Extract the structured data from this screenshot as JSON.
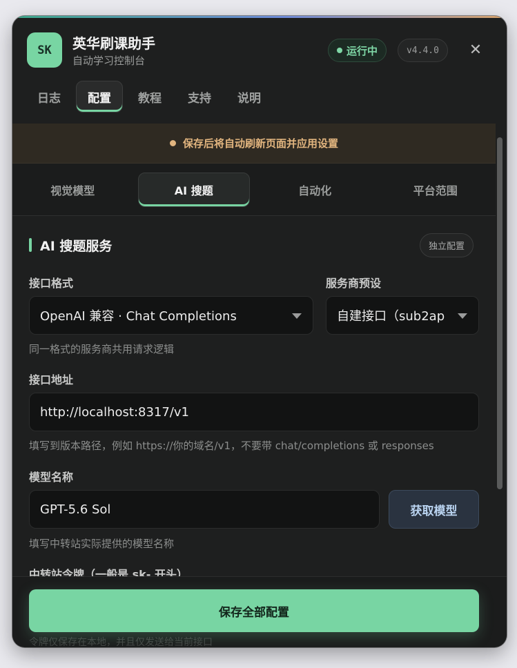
{
  "header": {
    "logo_text": "SK",
    "title": "英华刷课助手",
    "subtitle": "自动学习控制台",
    "status": "运行中",
    "version": "v4.4.0",
    "close_glyph": "✕"
  },
  "tabs": [
    {
      "label": "日志"
    },
    {
      "label": "配置",
      "active": true
    },
    {
      "label": "教程"
    },
    {
      "label": "支持"
    },
    {
      "label": "说明"
    }
  ],
  "notice": "保存后将自动刷新页面并应用设置",
  "subtabs": [
    {
      "label": "视觉模型"
    },
    {
      "label": "AI 搜题",
      "active": true
    },
    {
      "label": "自动化"
    },
    {
      "label": "平台范围"
    }
  ],
  "section": {
    "title": "AI 搜题服务",
    "independent_label": "独立配置"
  },
  "form": {
    "format_label": "接口格式",
    "format_value": "OpenAI 兼容 · Chat Completions",
    "provider_label": "服务商预设",
    "provider_value": "自建接口（sub2ap",
    "format_hint": "同一格式的服务商共用请求逻辑",
    "endpoint_label": "接口地址",
    "endpoint_value": "http://localhost:8317/v1",
    "endpoint_hint": "填写到版本路径，例如 https://你的域名/v1，不要带 chat/completions 或 responses",
    "model_label": "模型名称",
    "model_value": "GPT-5.6 Sol",
    "fetch_label": "获取模型",
    "model_hint": "填写中转站实际提供的模型名称",
    "token_label": "中转站令牌（一般是 sk- 开头）"
  },
  "footer": {
    "save_label": "保存全部配置",
    "behind_text": "令牌仅保存在本地，并且仅发送给当前接口"
  },
  "colors": {
    "accent": "#78d5a3",
    "warning": "#e2b57f",
    "panel_bg": "#1e1f1f"
  }
}
